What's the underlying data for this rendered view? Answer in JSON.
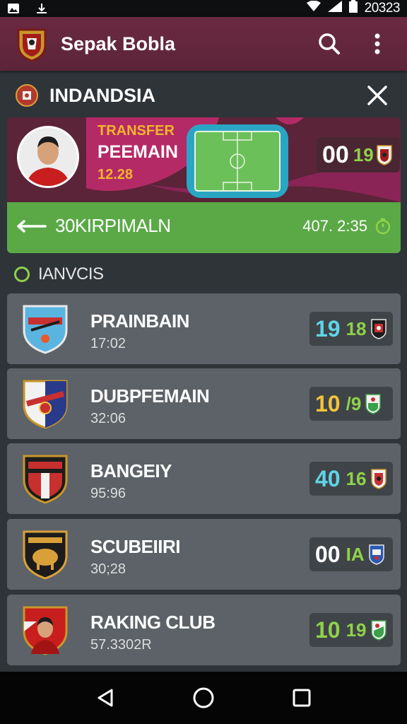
{
  "status_bar": {
    "time": "20323"
  },
  "app_bar": {
    "title": "Sepak Bobla",
    "actions": [
      "search-icon",
      "more-vert-icon"
    ]
  },
  "section": {
    "title": "INDANDSIA",
    "close_icon": "close-icon"
  },
  "feature": {
    "line1": "TRANSFER",
    "line2": "PEEMAIN",
    "line3": "12.28",
    "score_main": "00",
    "score_sub": "19",
    "name": "30KIRPIMALN",
    "time": "407. 2:35",
    "colors": {
      "accent_green": "#5aa946",
      "maroon": "#5b2438",
      "gold": "#f3b62c",
      "cyan": "#2aa6c4"
    }
  },
  "list": {
    "heading": "IANVCIS",
    "rows": [
      {
        "name": "PRAINBAIN",
        "sub": "17:02",
        "score_main": "19",
        "score_sub": "18",
        "main_color": "#5fd4e6",
        "sub_color": "#8fd24a"
      },
      {
        "name": "DUBPFEMAIN",
        "sub": "32:06",
        "score_main": "10",
        "score_sub": "/9",
        "main_color": "#f3c43a",
        "sub_color": "#8fd24a"
      },
      {
        "name": "BANGEIY",
        "sub": "95:96",
        "score_main": "40",
        "score_sub": "16",
        "main_color": "#5fd4e6",
        "sub_color": "#8fd24a"
      },
      {
        "name": "SCUBEIIRI",
        "sub": "30;28",
        "score_main": "00",
        "score_sub": "IA",
        "main_color": "#ffffff",
        "sub_color": "#8fd24a"
      },
      {
        "name": "RAKING CLUB",
        "sub": "57.3302R",
        "score_main": "10",
        "score_sub": "19",
        "main_color": "#8fd24a",
        "sub_color": "#8fd24a"
      }
    ]
  },
  "nav": {
    "buttons": [
      "back-icon",
      "home-icon",
      "recents-icon"
    ]
  }
}
